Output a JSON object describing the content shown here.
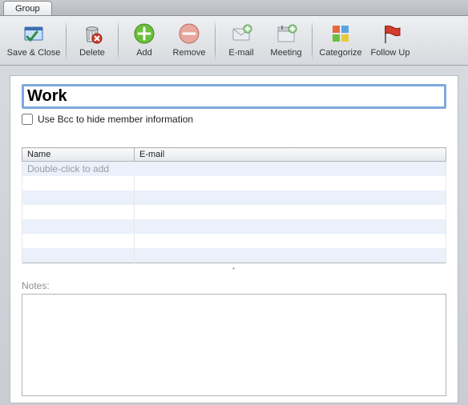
{
  "window": {
    "tab": "Group"
  },
  "toolbar": {
    "save_close": "Save & Close",
    "delete": "Delete",
    "add": "Add",
    "remove": "Remove",
    "email": "E-mail",
    "meeting": "Meeting",
    "categorize": "Categorize",
    "followup": "Follow Up"
  },
  "group": {
    "title": "Work",
    "bcc_label": "Use Bcc to hide member information",
    "bcc_checked": false
  },
  "table": {
    "columns": {
      "name": "Name",
      "email": "E-mail"
    },
    "placeholder": "Double-click to add"
  },
  "notes": {
    "label": "Notes:",
    "value": ""
  }
}
